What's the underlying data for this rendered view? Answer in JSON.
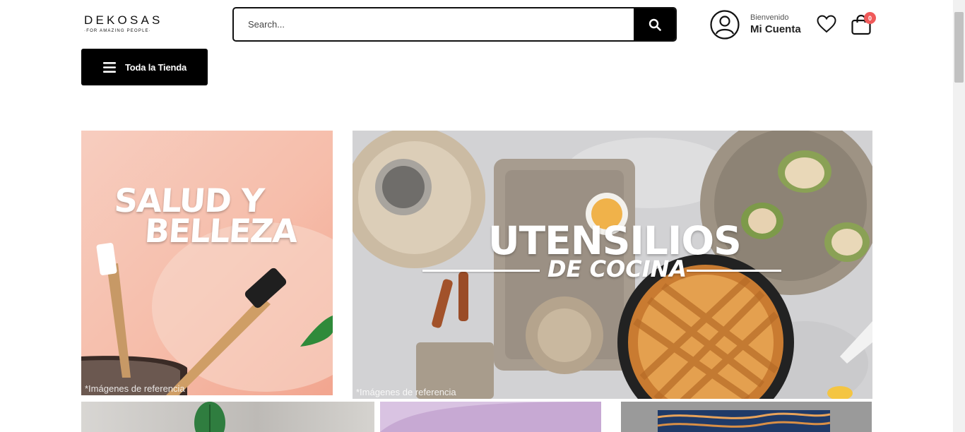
{
  "header": {
    "logo": {
      "name": "DEKOSAS",
      "tagline": "·FOR AMAZING PEOPLE·"
    },
    "search": {
      "placeholder": "Search..."
    },
    "account": {
      "greeting": "Bienvenido",
      "label": "Mi Cuenta"
    },
    "cart": {
      "count": "0"
    },
    "menu_button": {
      "label": "Toda la Tienda"
    }
  },
  "banners": {
    "salud": {
      "title_line1": "SALUD Y",
      "title_line2": "BELLEZA",
      "note": "*Imágenes de referencia"
    },
    "cocina": {
      "title_line1": "UTENSILIOS",
      "title_line2": "DE COCINA",
      "note": "*Imágenes de referencia"
    }
  },
  "colors": {
    "primary": "#000000",
    "cart_badge": "#f05a5a",
    "salud_bg": "#f6bdaa",
    "cocina_bg": "#cfcfd0",
    "lavender": "#c7a9d3"
  },
  "icons": [
    "search-icon",
    "user-icon",
    "heart-icon",
    "bag-icon",
    "hamburger-icon"
  ]
}
